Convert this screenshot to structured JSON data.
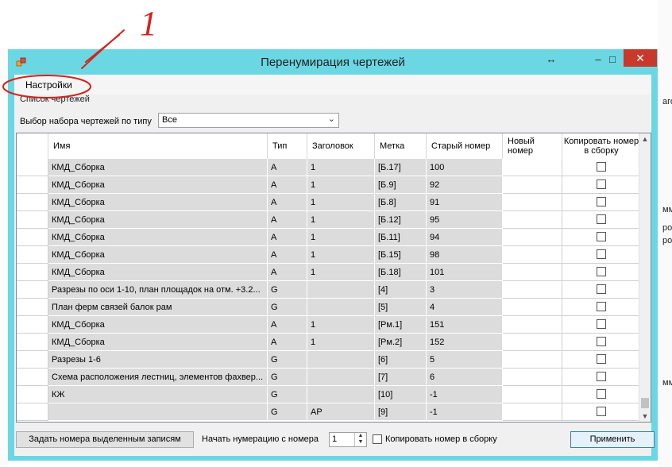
{
  "annotation": {
    "number": "1"
  },
  "window": {
    "title": "Перенумирация чертежей",
    "controls": {
      "resize": "↔",
      "minimize": "–",
      "maximize": "□",
      "close": "✕"
    }
  },
  "menu": {
    "settings": "Настройки"
  },
  "group_label": "Список чертежей",
  "filter": {
    "label": "Выбор набора чертежей по типу",
    "value": "Все"
  },
  "table": {
    "headers": {
      "name": "Имя",
      "type": "Тип",
      "heading": "Заголовок",
      "mark": "Метка",
      "old_number": "Старый номер",
      "new_number": "Новый номер",
      "copy_to_assembly": "Копировать номер в сборку"
    },
    "rows": [
      {
        "name": "КМД_Сборка",
        "type": "А",
        "heading": "1",
        "mark": "[Б.17]",
        "old": "100",
        "new": "",
        "copy": false
      },
      {
        "name": "КМД_Сборка",
        "type": "А",
        "heading": "1",
        "mark": "[Б.9]",
        "old": "92",
        "new": "",
        "copy": false
      },
      {
        "name": "КМД_Сборка",
        "type": "А",
        "heading": "1",
        "mark": "[Б.8]",
        "old": "91",
        "new": "",
        "copy": false
      },
      {
        "name": "КМД_Сборка",
        "type": "А",
        "heading": "1",
        "mark": "[Б.12]",
        "old": "95",
        "new": "",
        "copy": false
      },
      {
        "name": "КМД_Сборка",
        "type": "А",
        "heading": "1",
        "mark": "[Б.11]",
        "old": "94",
        "new": "",
        "copy": false
      },
      {
        "name": "КМД_Сборка",
        "type": "А",
        "heading": "1",
        "mark": "[Б.15]",
        "old": "98",
        "new": "",
        "copy": false
      },
      {
        "name": "КМД_Сборка",
        "type": "А",
        "heading": "1",
        "mark": "[Б.18]",
        "old": "101",
        "new": "",
        "copy": false
      },
      {
        "name": "Разрезы по оси 1-10, план площадок на отм. +3.2...",
        "type": "G",
        "heading": "",
        "mark": "[4]",
        "old": "3",
        "new": "",
        "copy": false
      },
      {
        "name": "План ферм связей балок рам",
        "type": "G",
        "heading": "",
        "mark": "[5]",
        "old": "4",
        "new": "",
        "copy": false
      },
      {
        "name": "КМД_Сборка",
        "type": "А",
        "heading": "1",
        "mark": "[Рм.1]",
        "old": "151",
        "new": "",
        "copy": false
      },
      {
        "name": "КМД_Сборка",
        "type": "А",
        "heading": "1",
        "mark": "[Рм.2]",
        "old": "152",
        "new": "",
        "copy": false
      },
      {
        "name": "Разрезы 1-6",
        "type": "G",
        "heading": "",
        "mark": "[6]",
        "old": "5",
        "new": "",
        "copy": false
      },
      {
        "name": "Схема расположения лестниц, элементов фахвер...",
        "type": "G",
        "heading": "",
        "mark": "[7]",
        "old": "6",
        "new": "",
        "copy": false
      },
      {
        "name": "КЖ",
        "type": "G",
        "heading": "",
        "mark": "[10]",
        "old": "-1",
        "new": "",
        "copy": false
      },
      {
        "name": "",
        "type": "G",
        "heading": "АР",
        "mark": "[9]",
        "old": "-1",
        "new": "",
        "copy": false
      }
    ]
  },
  "footer": {
    "assign_button": "Задать номера выделенным записям",
    "start_label": "Начать нумерацию с номера",
    "start_value": "1",
    "copy_label": "Копировать номер в сборку",
    "apply_button": "Применить"
  },
  "background_fragments": [
    "аго",
    "ммл",
    "ро",
    "ро",
    "ммл"
  ]
}
